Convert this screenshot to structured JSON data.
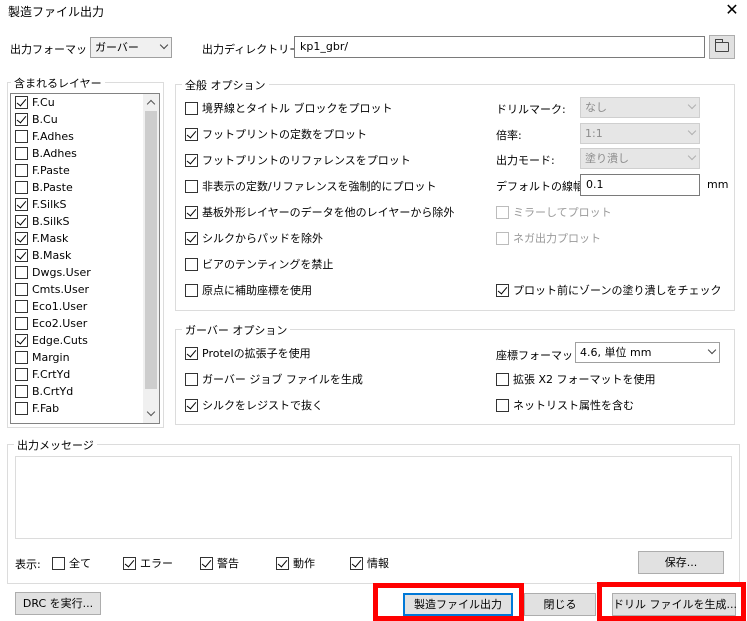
{
  "window": {
    "title": "製造ファイル出力"
  },
  "top": {
    "format_label": "出力フォーマット:",
    "format_value": "ガーバー",
    "dir_label": "出力ディレクトリー:",
    "dir_value": "kp1_gbr/"
  },
  "layers": {
    "title": "含まれるレイヤー",
    "items": [
      {
        "label": "F.Cu",
        "checked": true
      },
      {
        "label": "B.Cu",
        "checked": true
      },
      {
        "label": "F.Adhes",
        "checked": false
      },
      {
        "label": "B.Adhes",
        "checked": false
      },
      {
        "label": "F.Paste",
        "checked": false
      },
      {
        "label": "B.Paste",
        "checked": false
      },
      {
        "label": "F.SilkS",
        "checked": true
      },
      {
        "label": "B.SilkS",
        "checked": true
      },
      {
        "label": "F.Mask",
        "checked": true
      },
      {
        "label": "B.Mask",
        "checked": true
      },
      {
        "label": "Dwgs.User",
        "checked": false
      },
      {
        "label": "Cmts.User",
        "checked": false
      },
      {
        "label": "Eco1.User",
        "checked": false
      },
      {
        "label": "Eco2.User",
        "checked": false
      },
      {
        "label": "Edge.Cuts",
        "checked": true
      },
      {
        "label": "Margin",
        "checked": false
      },
      {
        "label": "F.CrtYd",
        "checked": false
      },
      {
        "label": "B.CrtYd",
        "checked": false
      },
      {
        "label": "F.Fab",
        "checked": false
      }
    ]
  },
  "general": {
    "title": "全般 オプション",
    "options": [
      {
        "label": "境界線とタイトル ブロックをプロット",
        "checked": false
      },
      {
        "label": "フットプリントの定数をプロット",
        "checked": true
      },
      {
        "label": "フットプリントのリファレンスをプロット",
        "checked": true
      },
      {
        "label": "非表示の定数/リファレンスを強制的にプロット",
        "checked": false
      },
      {
        "label": "基板外形レイヤーのデータを他のレイヤーから除外",
        "checked": true
      },
      {
        "label": "シルクからパッドを除外",
        "checked": true
      },
      {
        "label": "ビアのテンティングを禁止",
        "checked": false
      },
      {
        "label": "原点に補助座標を使用",
        "checked": false
      }
    ],
    "drill_mark_label": "ドリルマーク:",
    "drill_mark_value": "なし",
    "scale_label": "倍率:",
    "scale_value": "1:1",
    "output_mode_label": "出力モード:",
    "output_mode_value": "塗り潰し",
    "line_width_label": "デフォルトの線幅:",
    "line_width_value": "0.1",
    "line_width_unit": "mm",
    "mirror_label": "ミラーしてプロット",
    "negative_label": "ネガ出力プロット",
    "zone_check_label": "プロット前にゾーンの塗り潰しをチェック",
    "zone_check_checked": true
  },
  "gerber": {
    "title": "ガーバー オプション",
    "protel_label": "Protelの拡張子を使用",
    "protel_checked": true,
    "jobfile_label": "ガーバー ジョブ ファイルを生成",
    "jobfile_checked": false,
    "subtract_label": "シルクをレジストで抜く",
    "subtract_checked": true,
    "coord_format_label": "座標フォーマット:",
    "coord_format_value": "4.6, 単位 mm",
    "x2_label": "拡張 X2 フォーマットを使用",
    "x2_checked": false,
    "netlist_label": "ネットリスト属性を含む",
    "netlist_checked": false
  },
  "messages": {
    "title": "出力メッセージ",
    "show_label": "表示:",
    "filters": [
      {
        "label": "全て",
        "checked": false
      },
      {
        "label": "エラー",
        "checked": true
      },
      {
        "label": "警告",
        "checked": true
      },
      {
        "label": "動作",
        "checked": true
      },
      {
        "label": "情報",
        "checked": true
      }
    ],
    "save_button": "保存..."
  },
  "buttons": {
    "drc": "DRC を実行...",
    "plot": "製造ファイル出力",
    "close": "閉じる",
    "drill": "ドリル ファイルを生成..."
  },
  "colors": {
    "highlight": "#ff0000",
    "default_border": "#0078d7"
  }
}
